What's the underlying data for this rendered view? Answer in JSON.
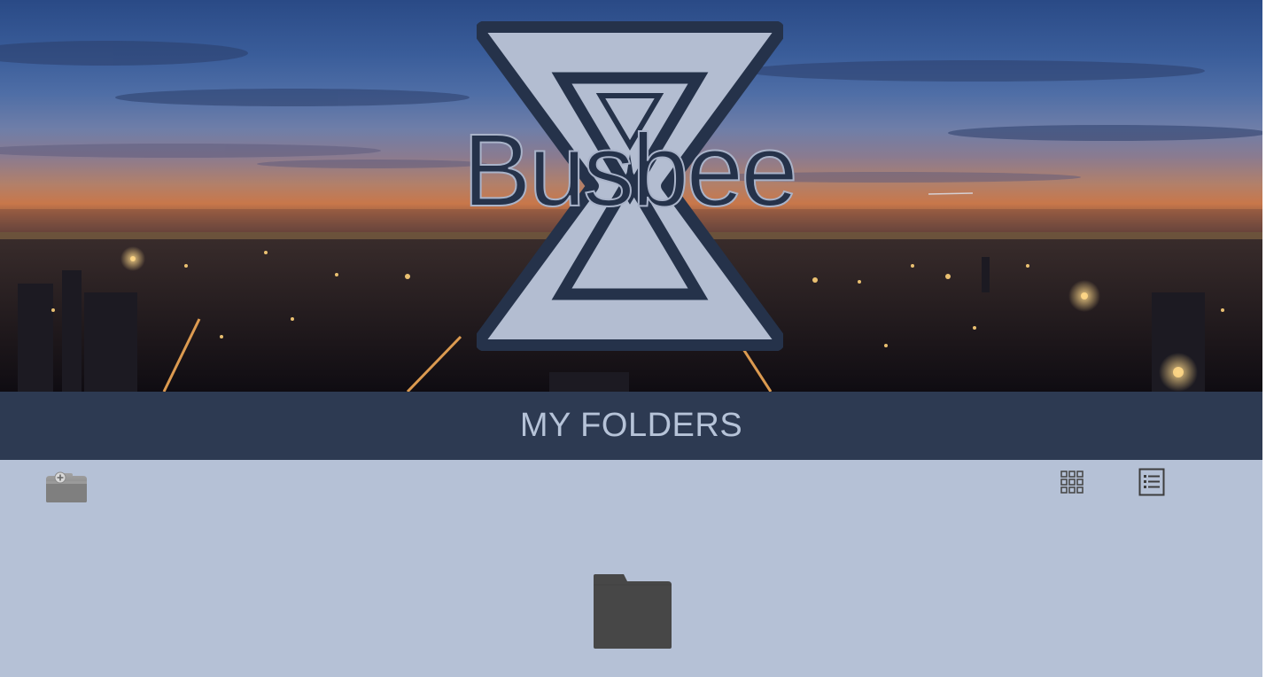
{
  "app": {
    "brand": "Busbee"
  },
  "header": {
    "title": "MY FOLDERS"
  },
  "toolbar": {
    "new_folder_icon": "new-folder-icon",
    "grid_view_icon": "grid-view-icon",
    "list_view_icon": "list-view-icon"
  },
  "folders": [
    {
      "name": "",
      "icon": "folder-icon"
    }
  ],
  "colors": {
    "title_bar_bg": "#2d3a52",
    "title_text": "#b6c3d8",
    "content_bg": "#b5c1d6",
    "logo_dark": "#25324a",
    "logo_light": "#b3bdd1",
    "folder": "#474747"
  }
}
